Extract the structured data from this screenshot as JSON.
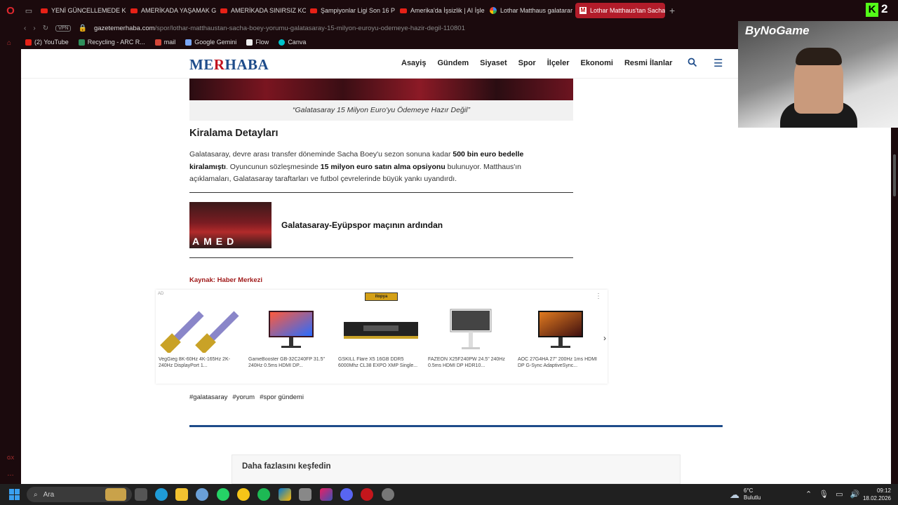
{
  "browser": {
    "tabs": [
      {
        "label": "YENİ GÜNCELLEMEDE KO",
        "icon": "youtube-icon",
        "active": false
      },
      {
        "label": "AMERİKADA YAŞAMAK Gİ",
        "icon": "youtube-icon",
        "active": false
      },
      {
        "label": "AMERİKADA SINIRSIZ KOR",
        "icon": "youtube-icon",
        "active": false
      },
      {
        "label": "Şampiyonlar Ligi Son 16 P",
        "icon": "youtube-icon",
        "active": false
      },
      {
        "label": "Amerika'da İşsizlik | AI İşle",
        "icon": "youtube-icon",
        "active": false
      },
      {
        "label": "Lothar Matthaus galatarar",
        "icon": "google-icon",
        "active": false
      },
      {
        "label": "Lothar Matthaus'tan Sacha",
        "icon": "merhaba-icon",
        "active": true
      }
    ],
    "new_tab": "+",
    "vpn": "VPN",
    "url_host": "gazetemerhaba.com",
    "url_path": "/spor/lothar-matthaustan-sacha-boey-yorumu-galatasaray-15-milyon-euroyu-odemeye-hazir-degil-110801",
    "bookmarks": [
      "(2) YouTube",
      "Recycling - ARC R...",
      "mail",
      "Google Gemini",
      "Flow",
      "Canva"
    ]
  },
  "site": {
    "logo_part1": "ME",
    "logo_part2": "R",
    "logo_part3": "HABA",
    "nav": [
      "Asayiş",
      "Gündem",
      "Siyaset",
      "Spor",
      "İlçeler",
      "Ekonomi",
      "Resmi İlanlar"
    ]
  },
  "article": {
    "caption": "“Galatasaray 15 Milyon Euro'yu Ödemeye Hazır Değil”",
    "section_heading": "Kiralama Detayları",
    "para_1": "Galatasaray, devre arası transfer döneminde Sacha Boey'u sezon sonuna kadar ",
    "para_bold_1": "500 bin euro bedelle kiralamıştı",
    "para_2": ". Oyuncunun sözleşmesinde ",
    "para_bold_2": "15 milyon euro satın alma opsiyonu",
    "para_3": " bulunuyor. Matthaus'ın açıklamaları, Galatasaray taraftarları ve futbol çevrelerinde büyük yankı uyandırdı.",
    "related_title": "Galatasaray-Eyüpspor maçının ardından",
    "related_thumb_text": "AMED",
    "source": "Kaynak: Haber Merkezi",
    "tags": [
      "#galatasaray",
      "#yorum",
      "#spor gündemi"
    ],
    "discover": "Daha fazlasını keşfedin"
  },
  "ad": {
    "label": "AD",
    "brand": "itopya",
    "items": [
      "VegGieg 8K-60Hz 4K-165Hz 2K-240Hz DisplayPort 1...",
      "GameBooster GB-32C240FP 31.5\" 240Hz 0.5ms HDMI DP...",
      "GSKILL Flare X5 16GB DDR5 6000Mhz CL38 EXPO XMP Single...",
      "FAZEON X25F240PW 24.5\" 240Hz 0.5ms HDMI DP HDR10...",
      "AOC 27G4HA 27\" 200Hz 1ms HDMI DP G-Sync AdaptiveSync..."
    ]
  },
  "overlay": {
    "cam_brand": "ByNoGame",
    "kick_logo": "K",
    "kick_count": "2"
  },
  "taskbar": {
    "search": "Ara",
    "weather_temp": "6°C",
    "weather_desc": "Bulutlu",
    "time": "09:12",
    "date": "18.02.2026"
  },
  "colors": {
    "brand_blue": "#1e4c8a",
    "brand_red": "#c1121f",
    "active_tab": "#b21c2a"
  }
}
